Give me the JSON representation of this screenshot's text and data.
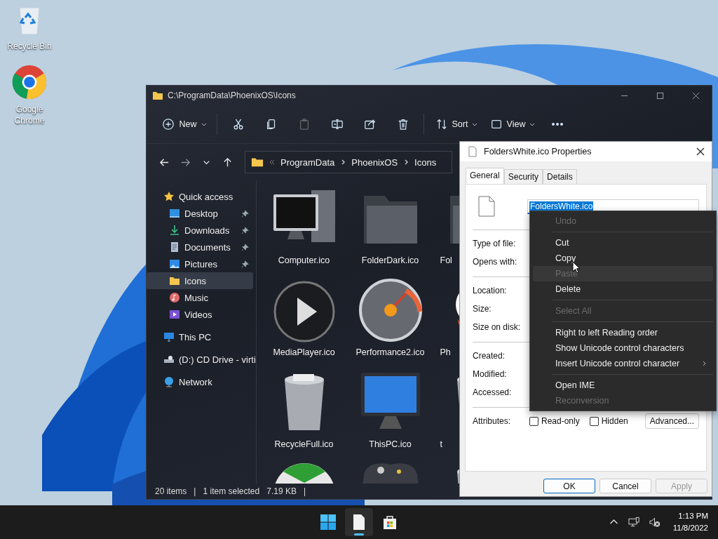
{
  "desktop_icons": [
    {
      "kind": "recycle",
      "label": "Recycle Bin"
    },
    {
      "kind": "browser",
      "label": "Google Chrome"
    }
  ],
  "explorer": {
    "title": "C:\\ProgramData\\PhoenixOS\\Icons",
    "toolbar": [
      {
        "kind": "new",
        "label": "New",
        "disabled": false
      },
      {
        "kind": "sep"
      },
      {
        "kind": "cut",
        "disabled": false
      },
      {
        "kind": "copy",
        "disabled": false
      },
      {
        "kind": "paste",
        "disabled": true
      },
      {
        "kind": "rename",
        "disabled": false
      },
      {
        "kind": "share",
        "disabled": false
      },
      {
        "kind": "delete",
        "disabled": false
      },
      {
        "kind": "sep"
      },
      {
        "kind": "sort",
        "label": "Sort",
        "disabled": false
      },
      {
        "kind": "view",
        "label": "View",
        "disabled": false
      },
      {
        "kind": "more",
        "disabled": false
      }
    ],
    "nav": [
      {
        "kind": "back",
        "disabled": false
      },
      {
        "kind": "forward",
        "disabled": true
      },
      {
        "kind": "recent",
        "disabled": false
      },
      {
        "kind": "up",
        "disabled": false
      }
    ],
    "breadcrumb": [
      "ProgramData",
      "PhoenixOS",
      "Icons"
    ],
    "sidebar": [
      {
        "label": "Quick access",
        "kind": "star",
        "selected": false,
        "children": [
          {
            "label": "Desktop",
            "kind": "desktop",
            "pinned": true,
            "selected": false
          },
          {
            "label": "Downloads",
            "kind": "download",
            "pinned": true,
            "selected": false
          },
          {
            "label": "Documents",
            "kind": "document",
            "pinned": true,
            "selected": false
          },
          {
            "label": "Pictures",
            "kind": "pictures",
            "pinned": true,
            "selected": false
          },
          {
            "label": "Icons",
            "kind": "folder",
            "pinned": false,
            "selected": true
          },
          {
            "label": "Music",
            "kind": "music",
            "pinned": false,
            "selected": false
          },
          {
            "label": "Videos",
            "kind": "video",
            "pinned": false,
            "selected": false
          }
        ]
      },
      {
        "label": "This PC",
        "kind": "pc",
        "selected": false
      },
      {
        "label": "(D:) CD Drive - virti",
        "kind": "drive",
        "selected": false
      },
      {
        "label": "Network",
        "kind": "network",
        "selected": false
      }
    ],
    "files": [
      {
        "kind": "computer",
        "label": "Computer.ico"
      },
      {
        "kind": "folder",
        "label": "FolderDark.ico"
      },
      {
        "kind": "folder",
        "label": "Fol"
      },
      {
        "kind": "media",
        "label": "MediaPlayer.ico"
      },
      {
        "kind": "gauge",
        "label": "Performance2.ico"
      },
      {
        "kind": "emblem",
        "label": "Ph"
      },
      {
        "kind": "bin",
        "label": "RecycleFull.ico"
      },
      {
        "kind": "monitor",
        "label": "ThisPC.ico"
      },
      {
        "kind": "bin",
        "label": "t"
      },
      {
        "kind": "ball"
      },
      {
        "kind": "gamepad"
      },
      {
        "kind": "bin"
      }
    ],
    "status": [
      "20 items",
      "|",
      "1 item selected",
      "7.19 KB",
      "|"
    ]
  },
  "dialog": {
    "title": "FoldersWhite.ico Properties",
    "tabs": [
      {
        "label": "General",
        "selected": true
      },
      {
        "label": "Security",
        "selected": false
      },
      {
        "label": "Details",
        "selected": false
      }
    ],
    "name": "FoldersWhite.ico",
    "groups": [
      [
        "Type of file:",
        "Opens with:"
      ],
      [
        "Location:",
        "Size:",
        "Size on disk:"
      ],
      [
        "Created:",
        "Modified:",
        "Accessed:"
      ]
    ],
    "attributes_label": "Attributes:",
    "attributes": [
      {
        "label": "Read-only",
        "checked": false
      },
      {
        "label": "Hidden",
        "checked": false
      }
    ],
    "advanced": "Advanced...",
    "buttons": [
      {
        "label": "OK",
        "default": true,
        "disabled": false
      },
      {
        "label": "Cancel",
        "default": false,
        "disabled": false
      },
      {
        "label": "Apply",
        "default": false,
        "disabled": true
      }
    ]
  },
  "context_menu": [
    {
      "kind": "item",
      "label": "Undo",
      "disabled": true,
      "hovered": false
    },
    {
      "kind": "sep"
    },
    {
      "kind": "item",
      "label": "Cut",
      "disabled": false,
      "hovered": false
    },
    {
      "kind": "item",
      "label": "Copy",
      "disabled": false,
      "hovered": false
    },
    {
      "kind": "item",
      "label": "Paste",
      "disabled": true,
      "hovered": true
    },
    {
      "kind": "item",
      "label": "Delete",
      "disabled": false,
      "hovered": false
    },
    {
      "kind": "sep"
    },
    {
      "kind": "item",
      "label": "Select All",
      "disabled": true,
      "hovered": false
    },
    {
      "kind": "sep"
    },
    {
      "kind": "item",
      "label": "Right to left Reading order",
      "disabled": false,
      "hovered": false
    },
    {
      "kind": "item",
      "label": "Show Unicode control characters",
      "disabled": false,
      "hovered": false
    },
    {
      "kind": "submenu",
      "label": "Insert Unicode control character",
      "disabled": false,
      "hovered": false
    },
    {
      "kind": "sep"
    },
    {
      "kind": "item",
      "label": "Open IME",
      "disabled": false,
      "hovered": false
    },
    {
      "kind": "item",
      "label": "Reconversion",
      "disabled": true,
      "hovered": false
    }
  ],
  "taskbar": {
    "apps": [
      {
        "kind": "start",
        "active": false
      },
      {
        "kind": "file",
        "active": true
      },
      {
        "kind": "store",
        "active": false
      }
    ],
    "tray": [
      {
        "kind": "chevron"
      },
      {
        "kind": "network"
      },
      {
        "kind": "muted"
      }
    ],
    "time": "1:13 PM",
    "date": "11/8/2022"
  }
}
